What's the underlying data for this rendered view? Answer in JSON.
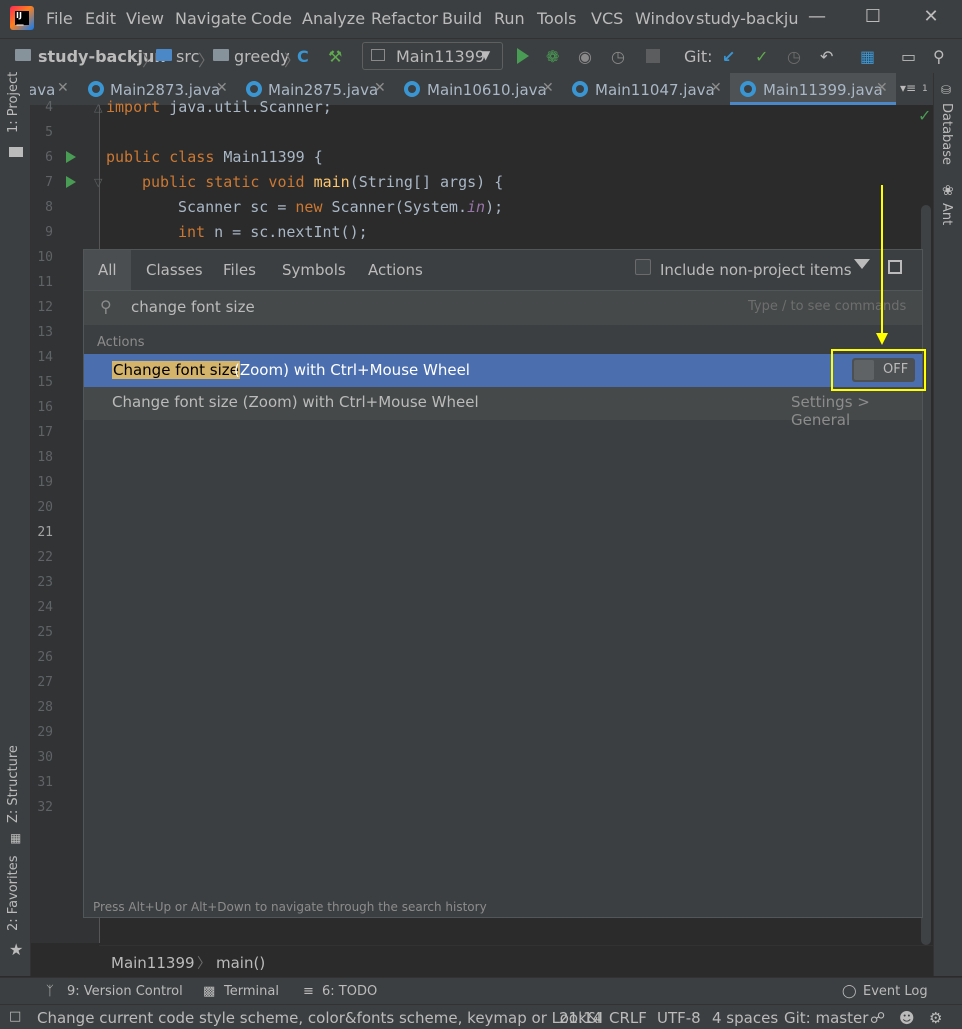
{
  "window": {
    "title": "study-backju",
    "menu": [
      {
        "label": "File",
        "ul": "F"
      },
      {
        "label": "Edit",
        "ul": "E"
      },
      {
        "label": "View",
        "ul": "V"
      },
      {
        "label": "Navigate",
        "ul": "N"
      },
      {
        "label": "Code",
        "ul": "C"
      },
      {
        "label": "Analyze",
        "ul": "z"
      },
      {
        "label": "Refactor",
        "ul": "R"
      },
      {
        "label": "Build",
        "ul": "B"
      },
      {
        "label": "Run",
        "ul": "u"
      },
      {
        "label": "Tools",
        "ul": "T"
      },
      {
        "label": "VCS",
        "ul": "S"
      },
      {
        "label": "Windov",
        "ul": "W"
      }
    ],
    "menu_labels": {
      "file": "File",
      "edit": "Edit",
      "view": "View",
      "navigate": "Navigate",
      "code": "Code",
      "analyze": "Analyze",
      "refactor": "Refactor",
      "build": "Build",
      "run": "Run",
      "tools": "Tools",
      "vcs": "VCS",
      "window": "Windov"
    }
  },
  "toolbar": {
    "project": "study-backjun",
    "src": "src",
    "package": "greedy",
    "run_config": "Main11399",
    "git_label": "Git:"
  },
  "tabs": [
    {
      "label": "ava",
      "active": false
    },
    {
      "label": "Main2873.java",
      "active": false
    },
    {
      "label": "Main2875.java",
      "active": false
    },
    {
      "label": "Main10610.java",
      "active": false
    },
    {
      "label": "Main11047.java",
      "active": false
    },
    {
      "label": "Main11399.java",
      "active": true
    }
  ],
  "tabs_overflow": "1",
  "left_tools": {
    "project": "1: Project",
    "structure": "Z: Structure",
    "favorites": "2: Favorites"
  },
  "right_tools": {
    "database": "Database",
    "ant": "Ant"
  },
  "editor": {
    "line_numbers": [
      "4",
      "5",
      "6",
      "7",
      "8",
      "9",
      "10",
      "11",
      "12",
      "13",
      "14",
      "15",
      "16",
      "17",
      "18",
      "19",
      "20",
      "21",
      "22",
      "23",
      "24",
      "25",
      "26",
      "27",
      "28",
      "29",
      "30",
      "31",
      "32"
    ],
    "current_line": "21",
    "code": {
      "l4_kw": "import",
      "l4_rest": " java.util.Scanner;",
      "l6_kw": "public class",
      "l6_rest": " Main11399 {",
      "l7_kw": "public static void",
      "l7_fn": " main",
      "l7_rest": "(String[] args) {",
      "l8_a": "Scanner sc = ",
      "l8_kw": "new",
      "l8_b": " Scanner(System.",
      "l8_st": "in",
      "l8_c": ");",
      "l9_kw": "int",
      "l9_rest": " n = sc.nextInt();"
    }
  },
  "search_popup": {
    "tabs": [
      "All",
      "Classes",
      "Files",
      "Symbols",
      "Actions"
    ],
    "include_label": "Include non-project items",
    "include_checked": false,
    "query": "change font size",
    "query_hint": "Type / to see commands",
    "section": "Actions",
    "results": [
      {
        "match": "Change font size",
        "rest": " (Zoom) with Ctrl+Mouse Wheel",
        "toggle": "OFF",
        "selected": true
      },
      {
        "label": "Change font size (Zoom) with Ctrl+Mouse Wheel",
        "location": "Settings > General",
        "selected": false
      }
    ],
    "footer_hint": "Press Alt+Up or Alt+Down to navigate through the search history"
  },
  "editor_breadcrumb": {
    "class": "Main11399",
    "method": "main()"
  },
  "bottom_tools": {
    "vcs": "9: Version Control",
    "terminal": "Terminal",
    "todo": "6: TODO",
    "event_log": "Event Log"
  },
  "status": {
    "message": "Change current code style scheme, color&fonts scheme, keymap or Look&I",
    "position": "21:14",
    "line_sep": "CRLF",
    "encoding": "UTF-8",
    "indent": "4 spaces",
    "branch": "Git: master"
  },
  "colors": {
    "accent": "#4b6eaf",
    "highlight": "#ffff00",
    "run_green": "#499c54",
    "match_bg": "#d4b36b"
  }
}
